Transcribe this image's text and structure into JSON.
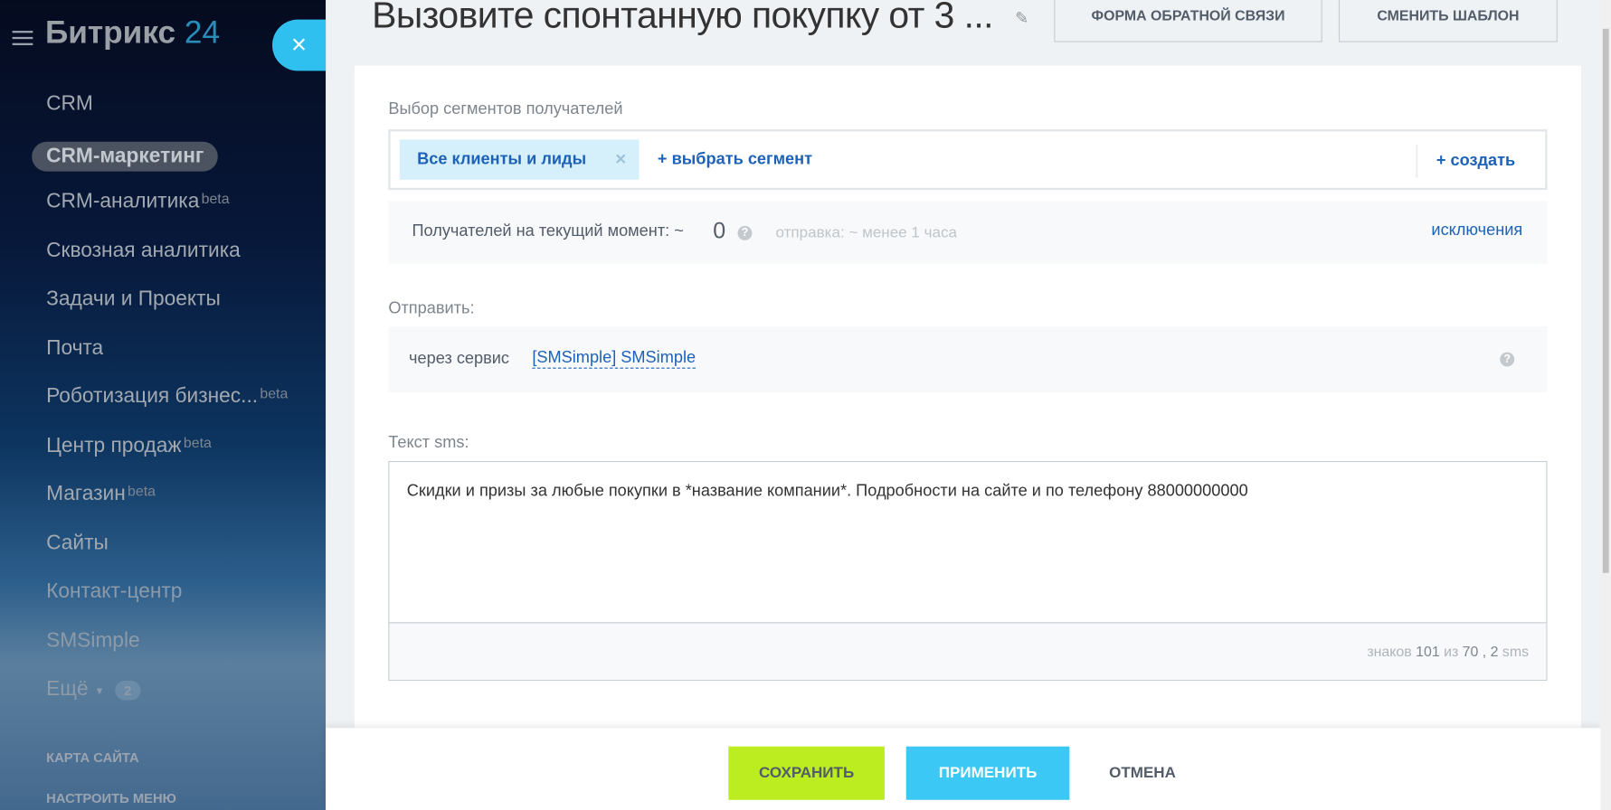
{
  "sidebar": {
    "logo_text": "Битрикс",
    "logo_num": "24",
    "items": [
      {
        "label": "CRM"
      },
      {
        "label": "CRM-маркетинг"
      },
      {
        "label": "CRM-аналитика",
        "sup": "beta"
      },
      {
        "label": "Сквозная аналитика"
      },
      {
        "label": "Задачи и Проекты"
      },
      {
        "label": "Почта"
      },
      {
        "label": "Роботизация бизнес...",
        "sup": "beta"
      },
      {
        "label": "Центр продаж",
        "sup": "beta"
      },
      {
        "label": "Магазин",
        "sup": "beta"
      },
      {
        "label": "Сайты"
      },
      {
        "label": "Контакт-центр"
      },
      {
        "label": "SMSimple"
      },
      {
        "label": "Ещё",
        "badge": "2"
      }
    ],
    "site_map": "КАРТА САЙТА",
    "configure_menu": "НАСТРОИТЬ МЕНЮ"
  },
  "header": {
    "close": "×",
    "title": "Вызовите спонтанную покупку от 3 ...",
    "feedback_btn": "ФОРМА ОБРАТНОЙ СВЯЗИ",
    "change_template_btn": "СМЕНИТЬ ШАБЛОН"
  },
  "segments": {
    "label": "Выбор сегментов получателей",
    "chip": "Все клиенты и лиды",
    "select": "+ выбрать сегмент",
    "create": "+ создать"
  },
  "recipients": {
    "label": "Получателей на текущий момент: ~",
    "count": "0",
    "send_time": "отправка: ~ менее 1 часа",
    "exclusions": "исключения"
  },
  "send": {
    "label": "Отправить:",
    "via": "через сервис",
    "service": "[SMSimple] SMSimple"
  },
  "sms": {
    "label": "Текст sms:",
    "text": "Скидки и призы за любые покупки в *название компании*. Подробности на сайте и по телефону 88000000000",
    "c1": "знаков",
    "chars": "101",
    "c2": "из",
    "limit": "70",
    "c3": ",",
    "count": "2",
    "c4": "sms"
  },
  "footer": {
    "save": "СОХРАНИТЬ",
    "apply": "ПРИМЕНИТЬ",
    "cancel": "ОТМЕНА"
  },
  "colors": {
    "save": "#bbed21",
    "apply": "#3bc8f5",
    "link": "#1d62b7"
  }
}
